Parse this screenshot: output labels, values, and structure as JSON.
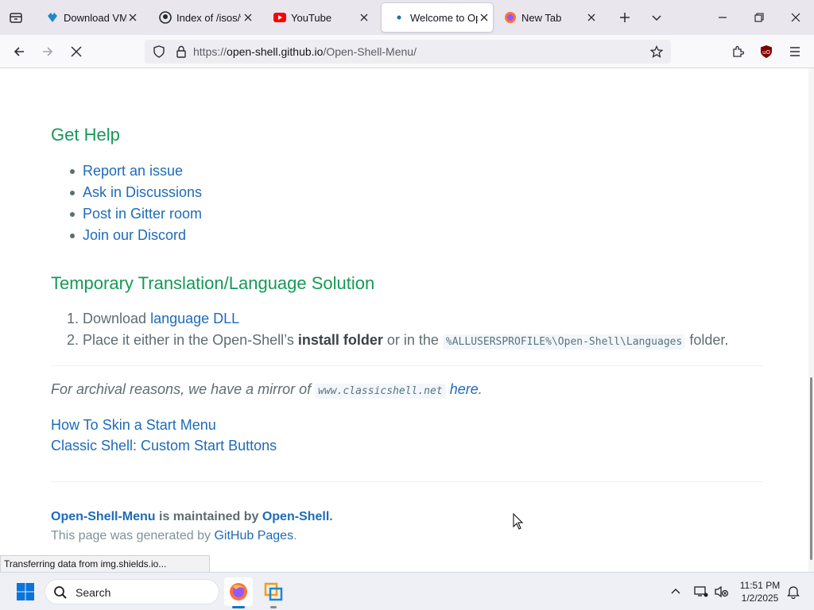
{
  "tabs": [
    {
      "title": "Download VMware",
      "icon": "vmware-icon"
    },
    {
      "title": "Index of /isos/win",
      "icon": "github-icon"
    },
    {
      "title": "YouTube",
      "icon": "youtube-icon"
    },
    {
      "title": "Welcome to Open-Shell",
      "icon": "open-shell-icon"
    },
    {
      "title": "New Tab",
      "icon": "firefox-icon"
    }
  ],
  "address": {
    "prefix": "https://",
    "host": "open-shell.github.io",
    "path": "/Open-Shell-Menu/"
  },
  "page": {
    "help_heading": "Get Help",
    "help_links": [
      "Report an issue",
      "Ask in Discussions",
      "Post in Gitter room",
      "Join our Discord"
    ],
    "translation_heading": "Temporary Translation/Language Solution",
    "step1_prefix": "1. Download ",
    "step1_link": "language DLL",
    "step2_prefix": "2. Place it either in the Open-Shell’s ",
    "step2_bold": "install folder",
    "step2_mid": " or in the ",
    "step2_code": "%ALLUSERSPROFILE%\\Open-Shell\\Languages",
    "step2_suffix": " folder.",
    "archive_prefix": "For archival reasons, we have a mirror of ",
    "archive_code": "www.classicshell.net",
    "archive_link": "here",
    "archive_suffix": ".",
    "skin_link": "How To Skin a Start Menu",
    "buttons_link": "Classic Shell: Custom Start Buttons",
    "footer_project": "Open-Shell-Menu",
    "footer_mid": " is maintained by ",
    "footer_owner": "Open-Shell",
    "footer_dot": ".",
    "footer_gen_prefix": "This page was generated by ",
    "footer_gen_link": "GitHub Pages",
    "footer_gen_suffix": "."
  },
  "status_text": "Transferring data from img.shields.io...",
  "taskbar": {
    "search_label": "Search",
    "time": "11:51 PM",
    "date": "1/2/2025"
  },
  "colors": {
    "heading": "#159957",
    "link": "#1e6bb8",
    "body_text": "#606c71"
  }
}
